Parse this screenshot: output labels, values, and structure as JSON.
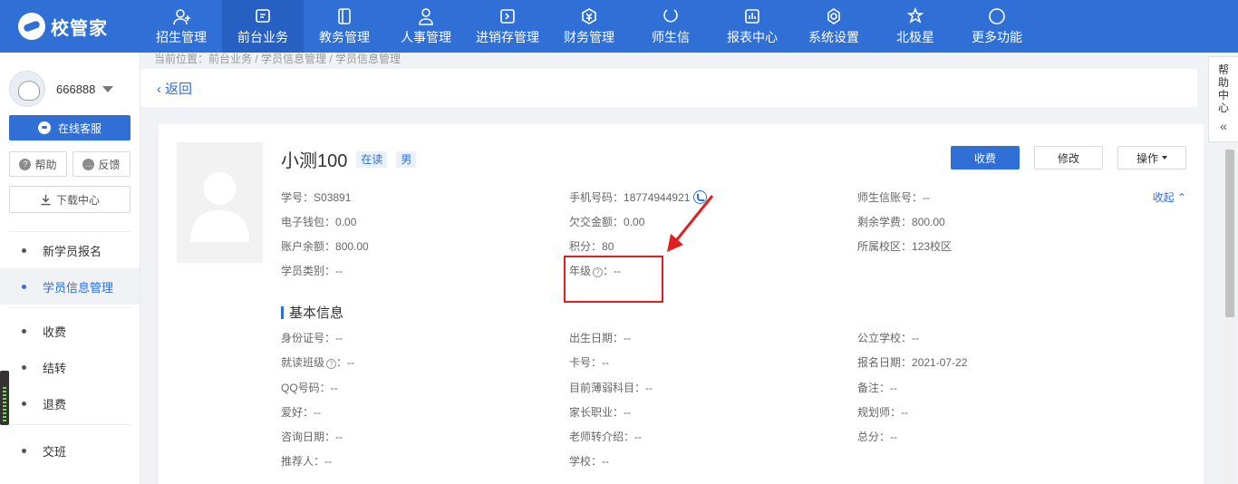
{
  "app": {
    "logo_text": "校管家"
  },
  "nav": [
    {
      "label": "招生管理",
      "icon": "user-plus-icon"
    },
    {
      "label": "前台业务",
      "icon": "monitor-icon"
    },
    {
      "label": "教务管理",
      "icon": "book-icon"
    },
    {
      "label": "人事管理",
      "icon": "person-icon"
    },
    {
      "label": "进销存管理",
      "icon": "inventory-icon"
    },
    {
      "label": "财务管理",
      "icon": "yuan-icon"
    },
    {
      "label": "师生信",
      "icon": "chat-icon"
    },
    {
      "label": "报表中心",
      "icon": "report-icon"
    },
    {
      "label": "系统设置",
      "icon": "settings-icon"
    },
    {
      "label": "北极星",
      "icon": "star-icon"
    },
    {
      "label": "更多功能",
      "icon": "more-icon"
    }
  ],
  "nav_active_index": 1,
  "sidebar": {
    "username": "666888",
    "online_service": "在线客服",
    "help": "帮助",
    "feedback": "反馈",
    "download": "下载中心",
    "menu_group1": [
      "新学员报名",
      "学员信息管理"
    ],
    "menu_group2": [
      "收费",
      "结转",
      "退费"
    ],
    "menu_group3": [
      "交班"
    ],
    "active_item": "学员信息管理"
  },
  "breadcrumb": "当前位置：前台业务 / 学员信息管理 / 学员信息管理",
  "back_label": "返回",
  "student": {
    "name": "小测100",
    "status_tag": "在读",
    "gender_tag": "男"
  },
  "actions": {
    "charge": "收费",
    "edit": "修改",
    "operate": "操作"
  },
  "collapse_label": "收起",
  "summary_fields": {
    "student_no": {
      "label": "学号：",
      "value": "S03891"
    },
    "phone": {
      "label": "手机号码：",
      "value": "18774944921"
    },
    "teacher_account": {
      "label": "师生信账号：",
      "value": "--"
    },
    "e_wallet": {
      "label": "电子钱包：",
      "value": "0.00"
    },
    "arrears": {
      "label": "欠交金额：",
      "value": "0.00"
    },
    "remaining_fee": {
      "label": "剩余学费：",
      "value": "800.00"
    },
    "balance": {
      "label": "账户余额：",
      "value": "800.00"
    },
    "points": {
      "label": "积分：",
      "value": "80"
    },
    "campus": {
      "label": "所属校区：",
      "value": "123校区"
    },
    "category": {
      "label": "学员类别：",
      "value": "--"
    },
    "grade": {
      "label": "年级",
      "suffix": "：",
      "value": "--"
    }
  },
  "basic_section_title": "基本信息",
  "basic_fields": {
    "id_no": {
      "label": "身份证号：",
      "value": "--"
    },
    "birthday": {
      "label": "出生日期：",
      "value": "--"
    },
    "public_school": {
      "label": "公立学校：",
      "value": "--"
    },
    "class": {
      "label": "就读班级",
      "suffix": "：",
      "value": "--"
    },
    "card_no": {
      "label": "卡号：",
      "value": "--"
    },
    "signup_date": {
      "label": "报名日期：",
      "value": "2021-07-22"
    },
    "qq": {
      "label": "QQ号码：",
      "value": "--"
    },
    "weak_subject": {
      "label": "目前薄弱科目：",
      "value": "--"
    },
    "remark": {
      "label": "备注：",
      "value": "--"
    },
    "hobby": {
      "label": "爱好：",
      "value": "--"
    },
    "parent_job": {
      "label": "家长职业：",
      "value": "--"
    },
    "planner": {
      "label": "规划师：",
      "value": "--"
    },
    "consult_date": {
      "label": "咨询日期：",
      "value": "--"
    },
    "teacher_referral": {
      "label": "老师转介绍：",
      "value": "--"
    },
    "score": {
      "label": "总分：",
      "value": "--"
    },
    "referrer": {
      "label": "推荐人：",
      "value": "--"
    },
    "school": {
      "label": "学校：",
      "value": "--"
    }
  },
  "help_center": [
    "帮",
    "助",
    "中",
    "心"
  ]
}
